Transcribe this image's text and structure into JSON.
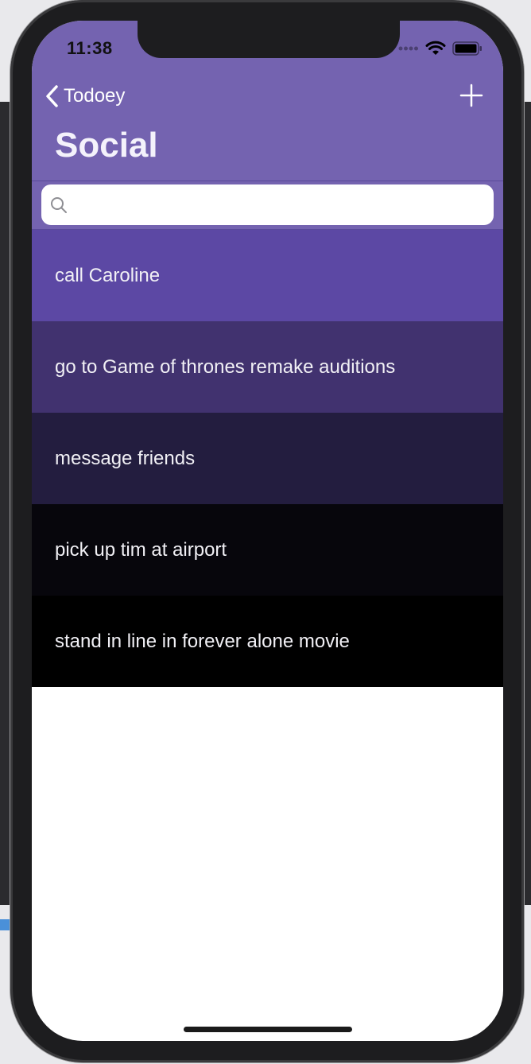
{
  "status_bar": {
    "time": "11:38",
    "icons": [
      "cellular-signal-icon",
      "wifi-icon",
      "battery-icon"
    ]
  },
  "nav": {
    "back_label": "Todoey",
    "back_icon": "chevron-left-icon",
    "add_icon": "plus-icon",
    "title": "Social"
  },
  "search": {
    "placeholder": "",
    "value": "",
    "icon": "search-icon"
  },
  "colors": {
    "nav_bar": "#7463b0",
    "text_on_rows": "#f1f0f5"
  },
  "items": [
    {
      "label": "call Caroline",
      "color": "#5c48a4"
    },
    {
      "label": "go to Game of thrones remake auditions",
      "color": "#41326f"
    },
    {
      "label": "message friends",
      "color": "#231d3f"
    },
    {
      "label": "pick up tim at airport",
      "color": "#07060c"
    },
    {
      "label": "stand in line in forever alone movie",
      "color": "#000000"
    }
  ]
}
